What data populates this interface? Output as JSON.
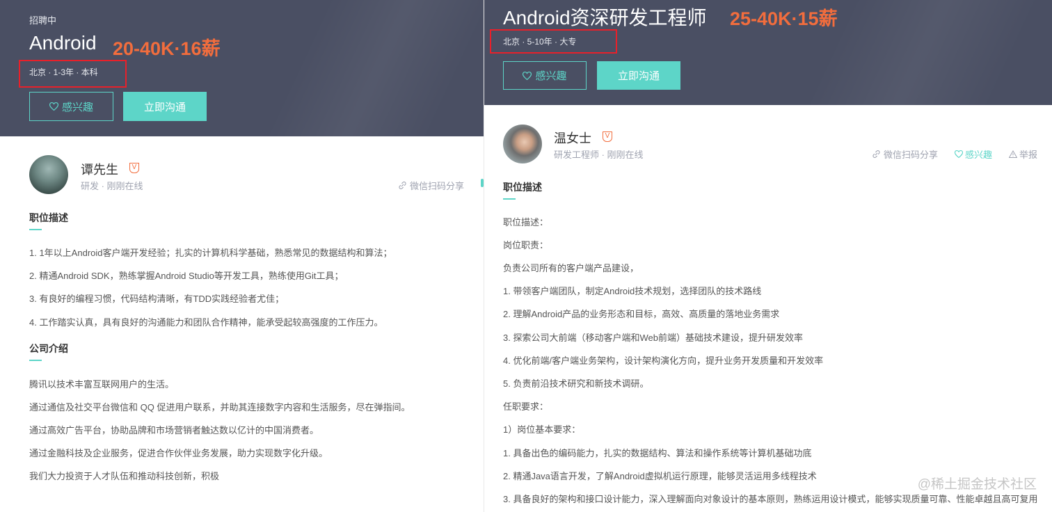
{
  "left": {
    "status": "招聘中",
    "title": "Android",
    "salary": "20-40K·16薪",
    "tags": "北京 · 1-3年 · 本科",
    "btn_interest": "感兴趣",
    "btn_chat": "立即沟通",
    "recruiter_name": "谭先生",
    "recruiter_meta": "研发 · 刚刚在线",
    "share": "微信扫码分享",
    "section_desc": "职位描述",
    "desc_lines": [
      "1. 1年以上Android客户端开发经验；扎实的计算机科学基础，熟悉常见的数据结构和算法；",
      "2. 精通Android SDK，熟练掌握Android Studio等开发工具，熟练使用Git工具；",
      "3. 有良好的编程习惯，代码结构清晰，有TDD实践经验者尤佳；",
      "4. 工作踏实认真，具有良好的沟通能力和团队合作精神，能承受起较高强度的工作压力。"
    ],
    "section_company": "公司介绍",
    "company_lines": [
      "腾讯以技术丰富互联网用户的生活。",
      "通过通信及社交平台微信和 QQ 促进用户联系，并助其连接数字内容和生活服务，尽在弹指间。",
      "通过高效广告平台，协助品牌和市场营销者触达数以亿计的中国消费者。",
      "通过金融科技及企业服务，促进合作伙伴业务发展，助力实现数字化升级。",
      "我们大力投资于人才队伍和推动科技创新，积极"
    ]
  },
  "right": {
    "title": "Android资深研发工程师",
    "salary": "25-40K·15薪",
    "tags": "北京 · 5-10年 · 大专",
    "btn_interest": "感兴趣",
    "btn_chat": "立即沟通",
    "recruiter_name": "温女士",
    "recruiter_meta": "研发工程师 · 刚刚在线",
    "share": "微信扫码分享",
    "interest": "感兴趣",
    "report": "举报",
    "section_desc": "职位描述",
    "desc_lines": [
      "职位描述：",
      "岗位职责：",
      "负责公司所有的客户端产品建设，",
      "1. 带领客户端团队，制定Android技术规划，选择团队的技术路线",
      "2. 理解Android产品的业务形态和目标，高效、高质量的落地业务需求",
      "3. 探索公司大前端（移动客户端和Web前端）基础技术建设，提升研发效率",
      "4. 优化前端/客户端业务架构，设计架构演化方向，提升业务开发质量和开发效率",
      "5. 负责前沿技术研究和新技术调研。",
      "任职要求：",
      "1）岗位基本要求：",
      "1. 具备出色的编码能力，扎实的数据结构、算法和操作系统等计算机基础功底",
      "2. 精通Java语言开发，了解Android虚拟机运行原理，能够灵活运用多线程技术",
      "3. 具备良好的架构和接口设计能力，深入理解面向对象设计的基本原则，熟练运用设计模式，能够实现质量可靠、性能卓越且高可复用"
    ]
  },
  "watermark": "@稀土掘金技术社区",
  "colors": {
    "header_bg": "#4a4f63",
    "accent_teal": "#5dd5c8",
    "salary_orange": "#f26d3d",
    "highlight_red": "#e8202a"
  },
  "icons": [
    "heart-icon",
    "link-icon",
    "verified-badge-icon",
    "warning-icon"
  ]
}
